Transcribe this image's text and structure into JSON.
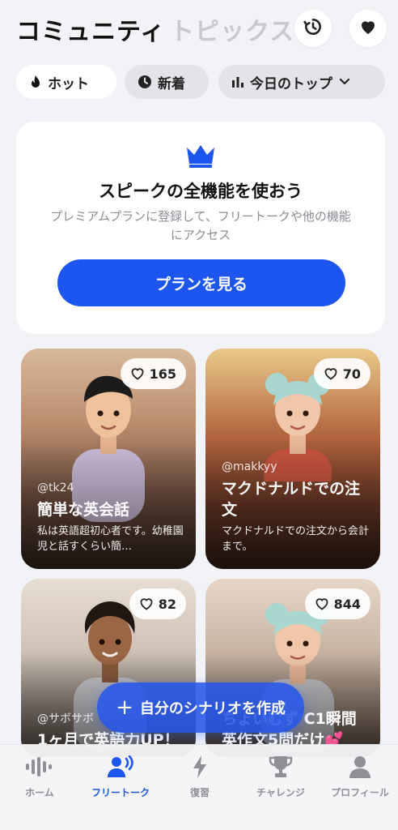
{
  "header": {
    "title": "コミュニティ",
    "subtitle": "トピックス"
  },
  "filters": {
    "hot": "ホット",
    "new": "新着",
    "top": "今日のトップ"
  },
  "premium": {
    "title": "スピークの全機能を使おう",
    "description": "プレミアムプランに登録して、フリートークや他の機能にアクセス",
    "button": "プランを見る",
    "accent_color": "#1d55ef"
  },
  "cards": [
    {
      "likes": "165",
      "author": "@tk24",
      "title": "簡単な英会話",
      "description": "私は英語超初心者です。幼稚園児と話すくらい簡…"
    },
    {
      "likes": "70",
      "author": "@makkyy",
      "title": "マクドナルドでの注文",
      "description": "マクドナルドでの注文から会計まで。"
    },
    {
      "likes": "82",
      "author": "@サボサボ",
      "title": "1ヶ月で英語力UP！"
    },
    {
      "likes": "844",
      "author": "",
      "title": "ちょいむず C1瞬間英作文5問だけ💕"
    }
  ],
  "fab": {
    "label": "自分のシナリオを作成"
  },
  "tabbar": {
    "items": [
      {
        "label": "ホーム",
        "icon": "waveform-icon"
      },
      {
        "label": "フリートーク",
        "icon": "speaking-person-icon"
      },
      {
        "label": "復習",
        "icon": "lightning-icon"
      },
      {
        "label": "チャレンジ",
        "icon": "trophy-icon"
      },
      {
        "label": "プロフィール",
        "icon": "person-icon"
      }
    ],
    "active_index": 1
  }
}
